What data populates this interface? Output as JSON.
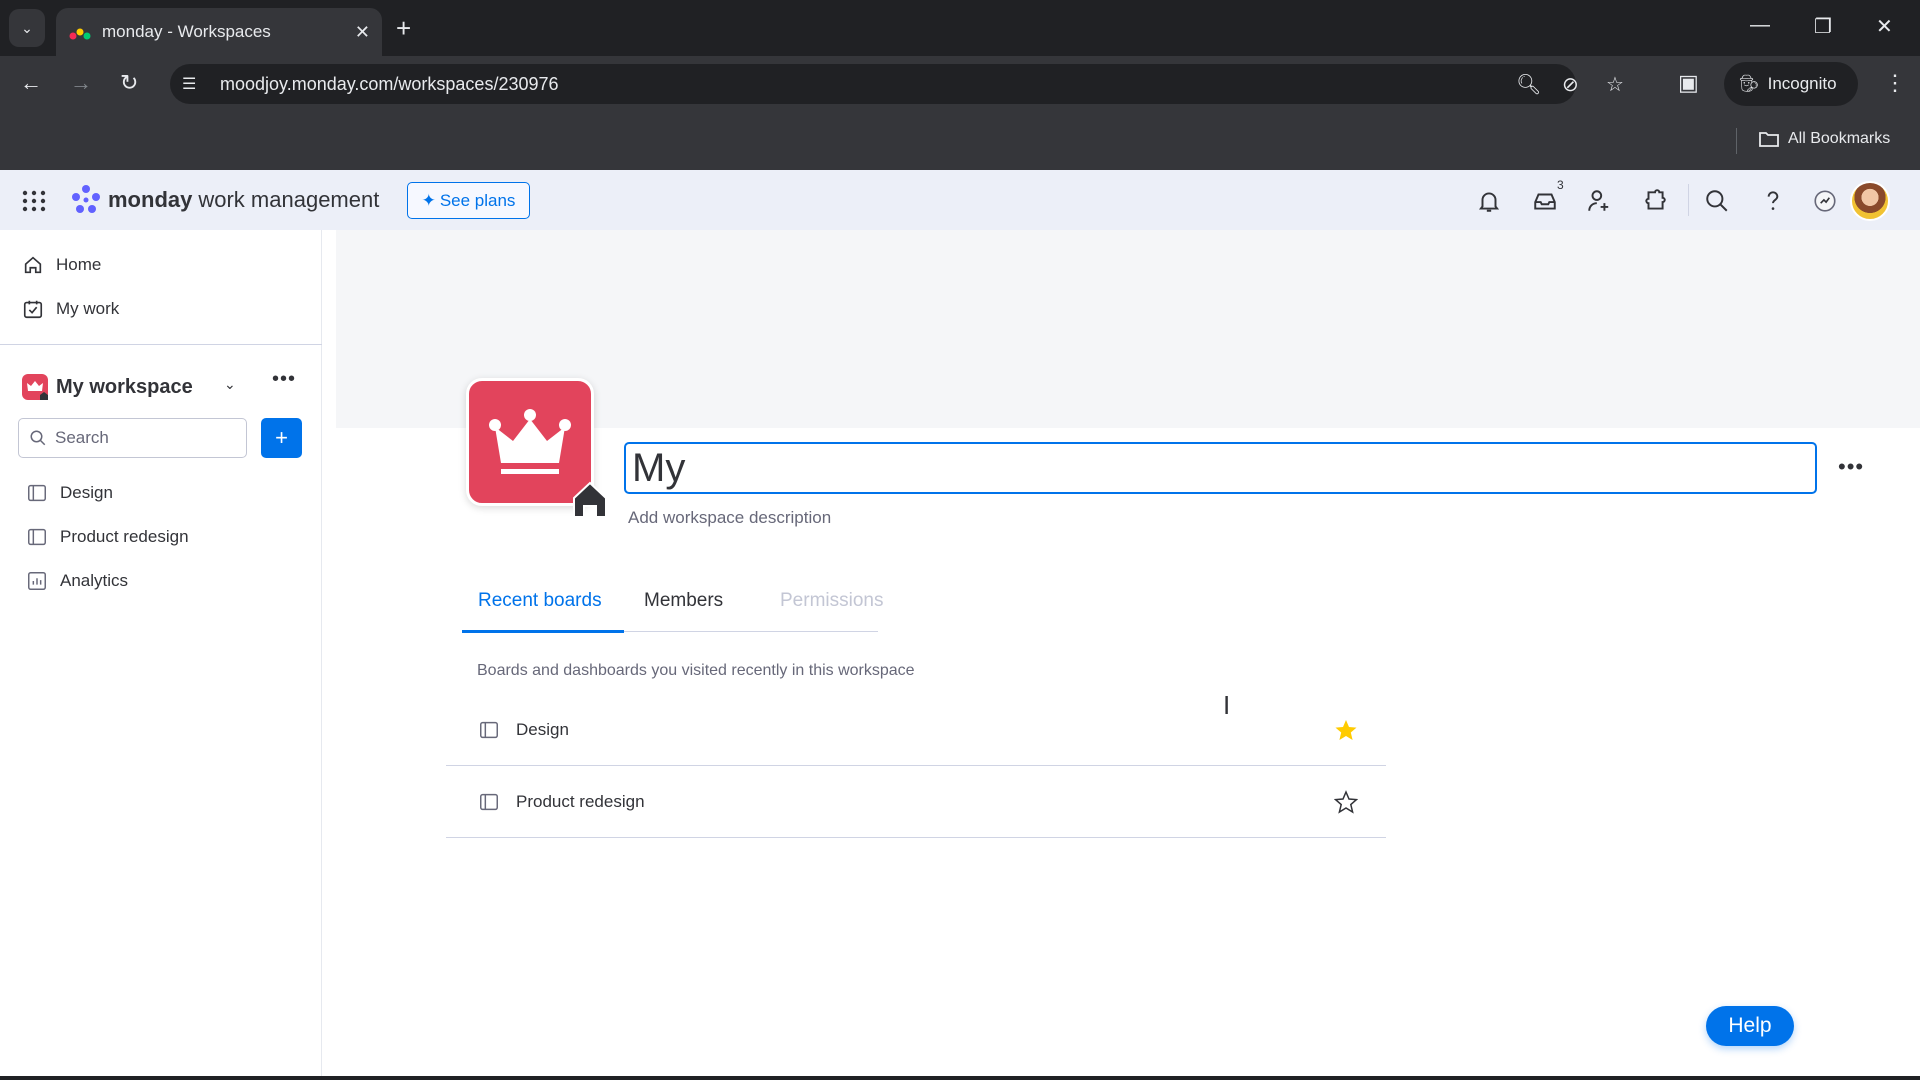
{
  "browser": {
    "tab_title": "monday - Workspaces",
    "url": "moodjoy.monday.com/workspaces/230976",
    "incognito_label": "Incognito",
    "bookmarks_label": "All Bookmarks",
    "icons": [
      "tab-list-icon",
      "close-tab-icon",
      "new-tab-icon",
      "back-icon",
      "forward-icon",
      "reload-icon",
      "site-settings-icon",
      "zoom-icon",
      "eye-off-icon",
      "bookmark-star-icon",
      "side-panel-icon",
      "incognito-icon",
      "menu-icon",
      "minimize-icon",
      "restore-icon",
      "close-window-icon",
      "folder-icon"
    ]
  },
  "app_header": {
    "brand": "monday",
    "product": "work management",
    "see_plans_label": "See plans",
    "inbox_badge": "3",
    "icons": [
      "apps-grid-icon",
      "bell-icon",
      "inbox-icon",
      "invite-user-icon",
      "integrations-icon",
      "search-icon",
      "help-icon",
      "update-feed-icon",
      "avatar"
    ]
  },
  "sidebar": {
    "nav": [
      {
        "label": "Home",
        "icon": "home-icon"
      },
      {
        "label": "My work",
        "icon": "my-work-icon"
      }
    ],
    "workspace_name": "My workspace",
    "search_placeholder": "Search",
    "add_label": "+",
    "boards": [
      {
        "label": "Design",
        "icon": "board-icon"
      },
      {
        "label": "Product redesign",
        "icon": "board-icon"
      },
      {
        "label": "Analytics",
        "icon": "dashboard-icon"
      }
    ]
  },
  "workspace": {
    "name_value": "My",
    "description_placeholder": "Add workspace description",
    "tabs": [
      {
        "label": "Recent boards",
        "active": true
      },
      {
        "label": "Members",
        "active": false
      },
      {
        "label": "Permissions",
        "active": false,
        "disabled": true
      }
    ],
    "recent_description": "Boards and dashboards you visited recently in this workspace",
    "recent_boards": [
      {
        "name": "Design",
        "starred": true
      },
      {
        "name": "Product redesign",
        "starred": false
      }
    ]
  },
  "help_label": "Help",
  "colors": {
    "accent": "#0073ea",
    "workspace_icon": "#e2445c",
    "star": "#ffcb00"
  }
}
